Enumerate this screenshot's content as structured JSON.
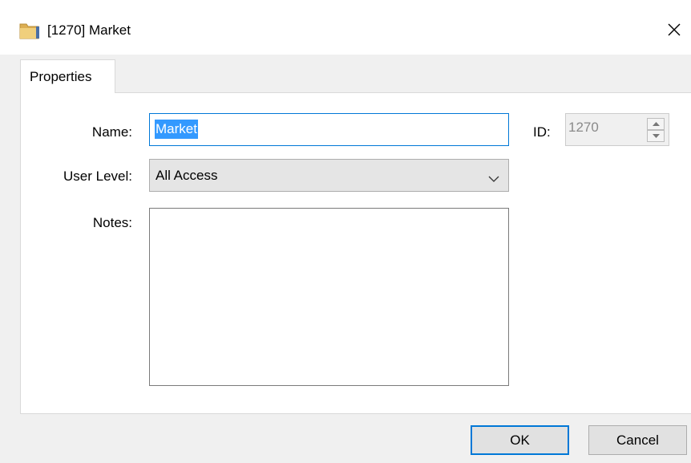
{
  "window": {
    "title": "[1270] Market",
    "icon": "folder-icon",
    "icon_color": "#e8c06a",
    "close_glyph": "✕"
  },
  "tabs": [
    {
      "label": "Properties",
      "selected": true
    }
  ],
  "form": {
    "name": {
      "label": "Name:",
      "value": "Market",
      "selected": true
    },
    "id": {
      "label": "ID:",
      "value": "1270",
      "enabled": false
    },
    "user_level": {
      "label": "User Level:",
      "value": "All Access"
    },
    "notes": {
      "label": "Notes:",
      "value": ""
    }
  },
  "buttons": {
    "ok_label": "OK",
    "cancel_label": "Cancel"
  },
  "colors": {
    "accent": "#0078d7",
    "selection": "#3399ff",
    "dialog_bg": "#f0f0f0",
    "panel_bg": "#ffffff"
  }
}
